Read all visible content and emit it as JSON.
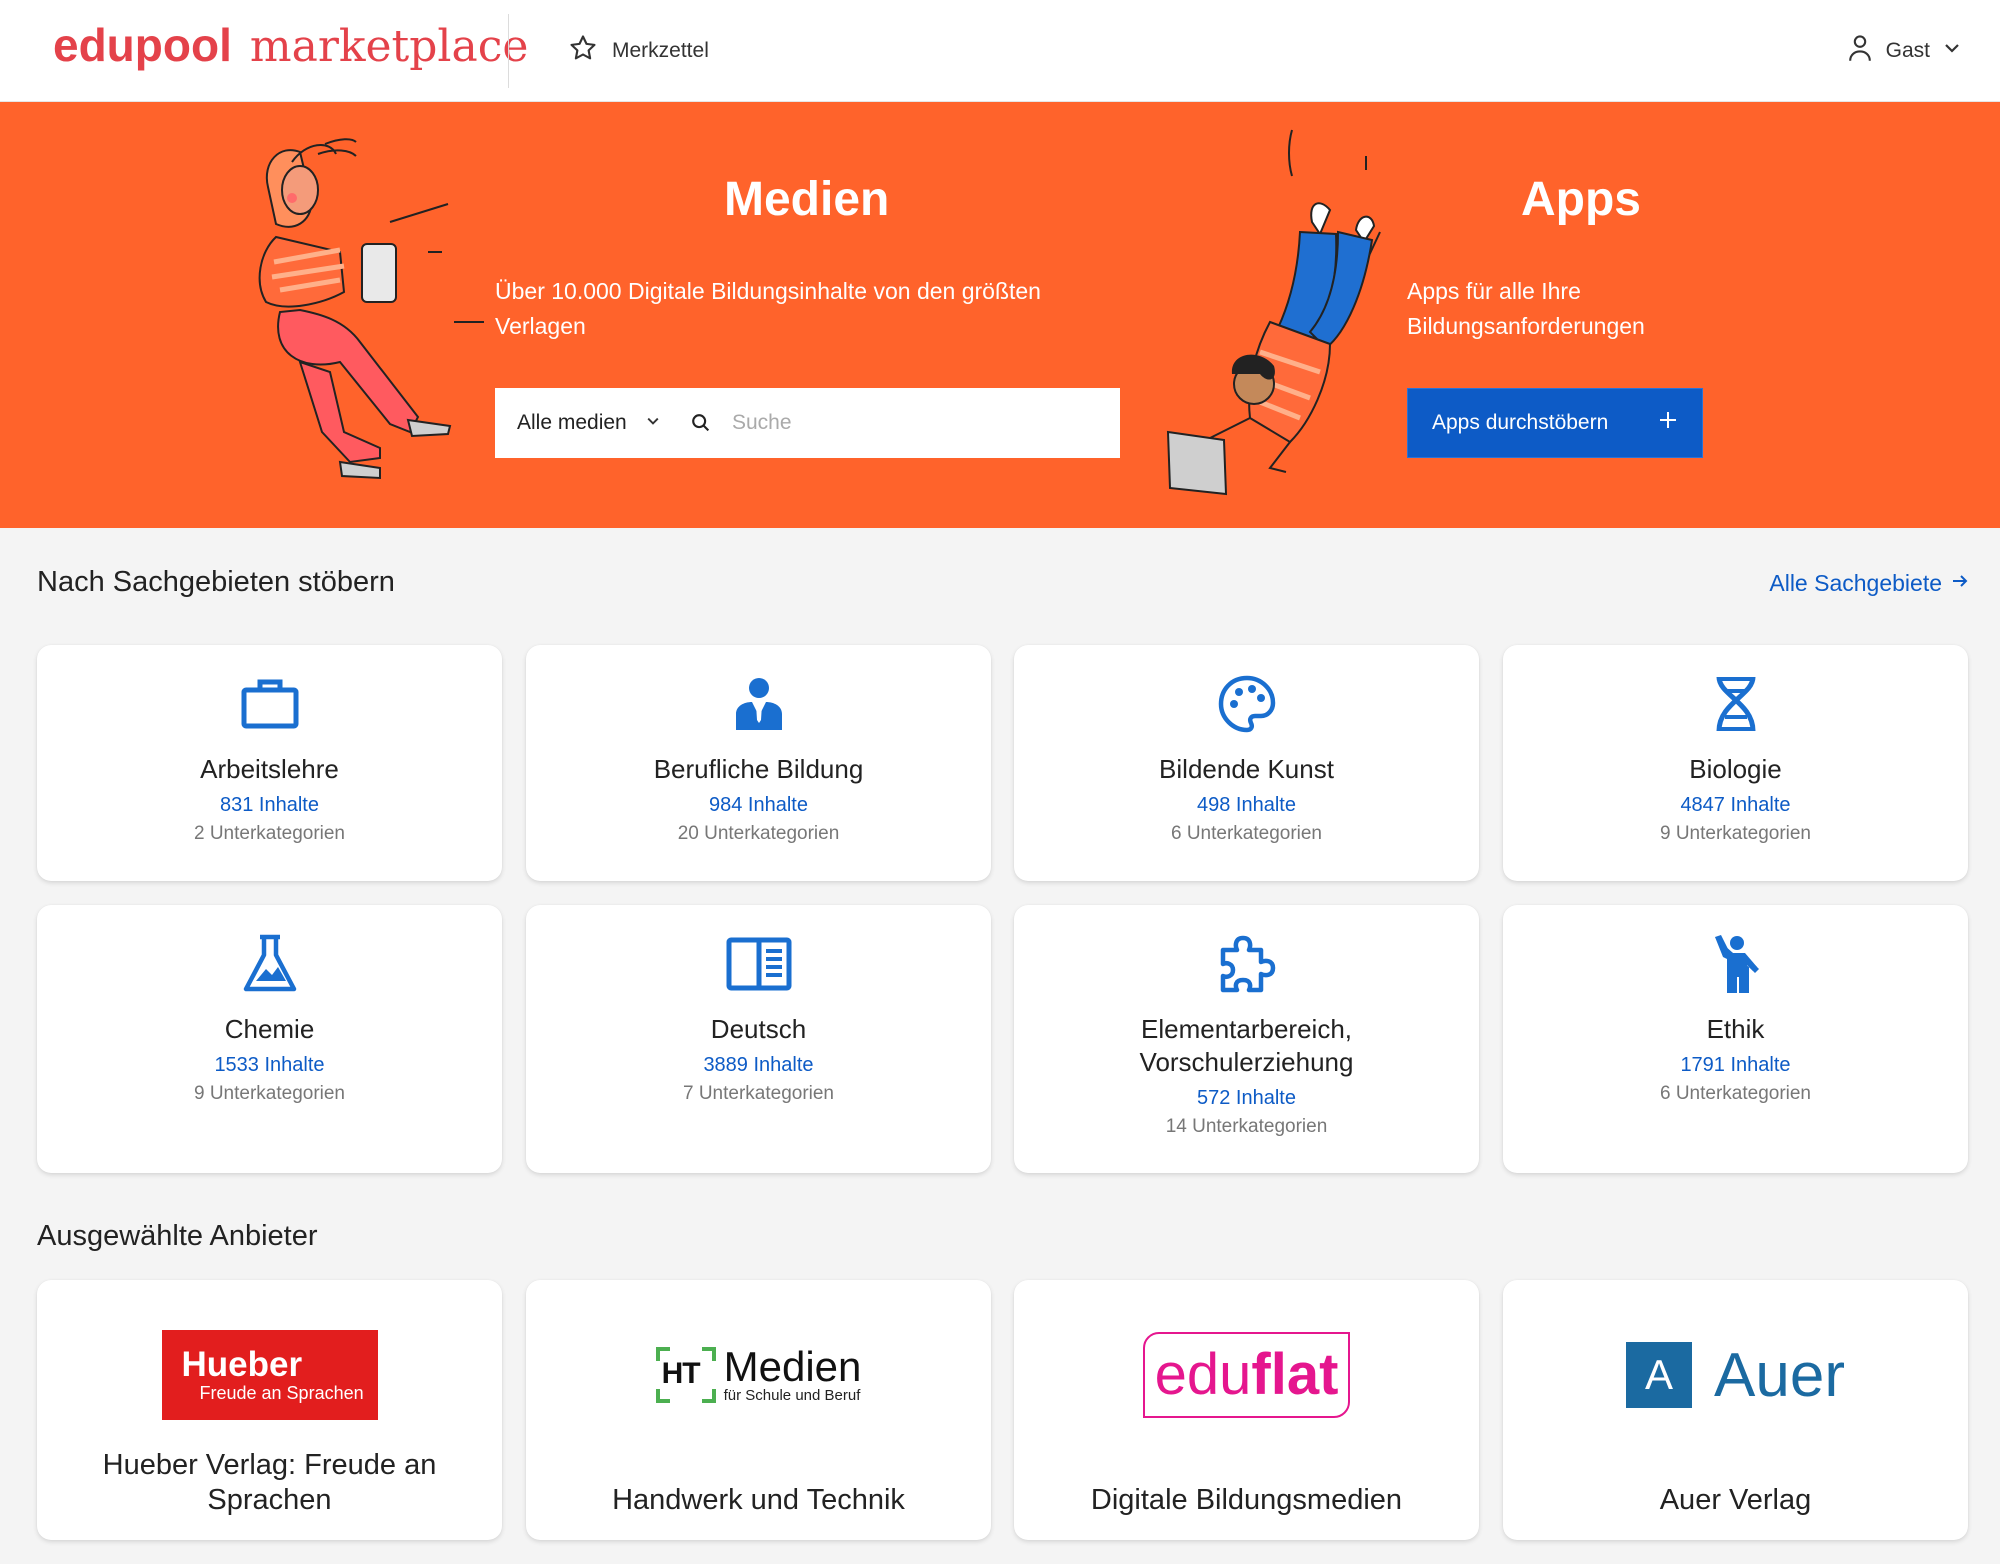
{
  "header": {
    "logo_bold": "edupool",
    "logo_serif": "marketplace",
    "merkzettel_label": "Merkzettel",
    "user_label": "Gast"
  },
  "hero": {
    "medien_title": "Medien",
    "medien_text": "Über 10.000 Digitale Bildungsinhalte von den größten Verlagen",
    "search_select_value": "Alle medien",
    "search_placeholder": "Suche",
    "apps_title": "Apps",
    "apps_text": "Apps für alle Ihre Bildungsanforderungen",
    "apps_button_label": "Apps durchstöbern",
    "colors": {
      "background": "#ff632b",
      "button": "#0d5bc6"
    }
  },
  "categories_section": {
    "title": "Nach Sachgebieten stöbern",
    "all_link": "Alle Sachgebiete",
    "items": [
      {
        "name": "Arbeitslehre",
        "count": "831 Inhalte",
        "sub": "2 Unterkategorien",
        "icon": "briefcase-icon"
      },
      {
        "name": "Berufliche Bildung",
        "count": "984 Inhalte",
        "sub": "20 Unterkategorien",
        "icon": "person-tie-icon"
      },
      {
        "name": "Bildende Kunst",
        "count": "498 Inhalte",
        "sub": "6 Unterkategorien",
        "icon": "palette-icon"
      },
      {
        "name": "Biologie",
        "count": "4847 Inhalte",
        "sub": "9 Unterkategorien",
        "icon": "dna-icon"
      },
      {
        "name": "Chemie",
        "count": "1533 Inhalte",
        "sub": "9 Unterkategorien",
        "icon": "flask-icon"
      },
      {
        "name": "Deutsch",
        "count": "3889 Inhalte",
        "sub": "7 Unterkategorien",
        "icon": "book-open-icon"
      },
      {
        "name": "Elementarbereich, Vorschulerziehung",
        "count": "572 Inhalte",
        "sub": "14 Unterkategorien",
        "icon": "puzzle-icon"
      },
      {
        "name": "Ethik",
        "count": "1791 Inhalte",
        "sub": "6 Unterkategorien",
        "icon": "person-raised-hand-icon"
      }
    ]
  },
  "providers_section": {
    "title": "Ausgewählte Anbieter",
    "items": [
      {
        "name": "Hueber Verlag: Freude an Sprachen",
        "logo_main": "Hueber",
        "logo_sub": "Freude an Sprachen"
      },
      {
        "name": "Handwerk und Technik",
        "logo_mark": "HT",
        "logo_main": "Medien",
        "logo_sub": "für Schule und Beruf"
      },
      {
        "name": "Digitale Bildungsmedien",
        "logo_main": "edu",
        "logo_bold": "flat"
      },
      {
        "name": "Auer Verlag",
        "logo_mark": "A",
        "logo_main": "Auer"
      }
    ]
  }
}
